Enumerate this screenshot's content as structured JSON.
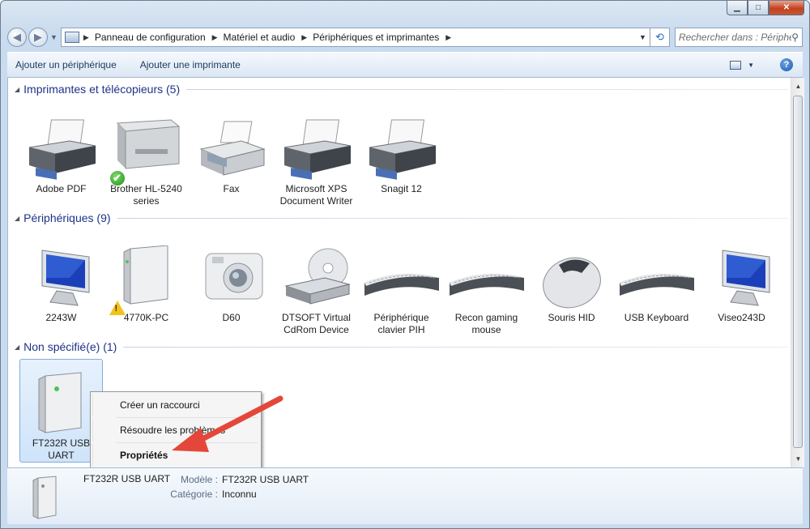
{
  "window": {
    "minimize": "▁",
    "maximize": "□",
    "close": "✕"
  },
  "nav": {
    "back": "◀",
    "forward": "▶",
    "breadcrumbs": [
      "Panneau de configuration",
      "Matériel et audio",
      "Périphériques et imprimantes"
    ],
    "search_placeholder": "Rechercher dans : Périphér..."
  },
  "commands": {
    "add_device": "Ajouter un périphérique",
    "add_printer": "Ajouter une imprimante"
  },
  "groups": [
    {
      "title": "Imprimantes et télécopieurs (5)",
      "items": [
        {
          "label": "Adobe PDF",
          "icon": "printer-icon"
        },
        {
          "label": "Brother HL-5240 series",
          "icon": "laser-printer-icon",
          "badge": "ok"
        },
        {
          "label": "Fax",
          "icon": "fax-icon"
        },
        {
          "label": "Microsoft XPS Document Writer",
          "icon": "printer-icon"
        },
        {
          "label": "Snagit 12",
          "icon": "printer-icon"
        }
      ]
    },
    {
      "title": "Périphériques (9)",
      "items": [
        {
          "label": "2243W",
          "icon": "monitor-icon"
        },
        {
          "label": "4770K-PC",
          "icon": "computer-tower-icon",
          "badge": "warning"
        },
        {
          "label": "D60",
          "icon": "camera-icon"
        },
        {
          "label": "DTSOFT Virtual CdRom Device",
          "icon": "cdrom-drive-icon"
        },
        {
          "label": "Périphérique clavier PIH",
          "icon": "keyboard-icon"
        },
        {
          "label": "Recon gaming mouse",
          "icon": "keyboard-icon"
        },
        {
          "label": "Souris HID",
          "icon": "mouse-icon"
        },
        {
          "label": "USB Keyboard",
          "icon": "keyboard-icon"
        },
        {
          "label": "Viseo243D",
          "icon": "monitor-icon"
        }
      ]
    },
    {
      "title": "Non spécifié(e) (1)",
      "items": [
        {
          "label": "FT232R USB UART",
          "icon": "usb-device-icon",
          "selected": true
        }
      ]
    }
  ],
  "context_menu": {
    "items": [
      "Créer un raccourci",
      "Résoudre les problèmes",
      "Propriétés"
    ]
  },
  "details": {
    "name": "FT232R USB UART",
    "model_label": "Modèle :",
    "model_value": "FT232R USB UART",
    "category_label": "Catégorie :",
    "category_value": "Inconnu"
  },
  "colors": {
    "group_title": "#1e3287",
    "annotation_arrow": "#e4473a"
  }
}
